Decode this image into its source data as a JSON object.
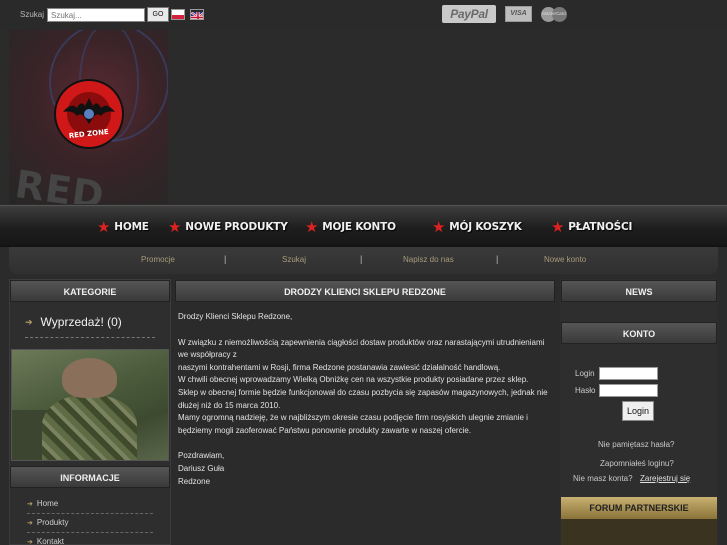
{
  "topbar": {
    "search_label": "Szukaj",
    "search_placeholder": "Szukaj...",
    "go_label": "GO",
    "payments": {
      "paypal": "PayPal",
      "visa": "VISA",
      "mastercard": "MasterCard"
    }
  },
  "banner": {
    "text": "RED",
    "logo_text": "RED ZONE"
  },
  "nav": {
    "items": [
      {
        "label": "HOME"
      },
      {
        "label": "NOWE PRODUKTY"
      },
      {
        "label": "MOJE KONTO"
      },
      {
        "label": "MÓJ KOSZYK"
      },
      {
        "label": "PŁATNOŚCI"
      }
    ]
  },
  "subnav": {
    "links": [
      "Promocje",
      "Szukaj",
      "Napisz do nas",
      "Nowe konto"
    ],
    "separator": "|"
  },
  "left": {
    "categories_title": "KATEGORIE",
    "category_items": [
      "Wyprzedaż! (0)"
    ],
    "info_title": "INFORMACJE",
    "info_links": [
      "Home",
      "Produkty",
      "Kontakt"
    ]
  },
  "center": {
    "title": "DRODZY KLIENCI SKLEPU REDZONE",
    "paragraphs": [
      "Drodzy Klienci Sklepu Redzone,",
      "W związku z niemożliwością zapewnienia ciągłości dostaw produktów oraz narastającymi utrudnieniami we współpracy z\nnaszymi kontrahentami w Rosji, firma Redzone postanawia zawiesić działalność handlową.\nW chwili obecnej wprowadzamy Wielką Obniżkę cen na wszystkie produkty posiadane przez sklep.\nSklep w obecnej formie będzie funkcjonował do czasu pozbycia się zapasów magazynowych, jednak nie dłużej niż do 15 marca 2010.\nMamy ogromną nadzieję, że w najbliższym okresie czasu podjęcie firm rosyjskich ulegnie zmianie i będziemy mogli zaoferować Państwu ponownie produkty zawarte w naszej ofercie.",
      "Pozdrawiam,\nDariusz Guła\nRedzone"
    ]
  },
  "right": {
    "news_title": "NEWS",
    "account_title": "KONTO",
    "login_label": "Login",
    "password_label": "Hasło",
    "login_button": "Login",
    "forgot_password": "Nie pamiętasz hasła?",
    "forgot_login": "Zapomniałeś loginu?",
    "no_account": "Nie masz konta?",
    "register": "Zarejestruj się",
    "forum_title": "FORUM PARTNERSKIE"
  },
  "colors": {
    "background": "#2b2b2b",
    "accent_red": "#d22222",
    "link_gold": "#a89a7a",
    "forum_gold": "#c7b070"
  }
}
